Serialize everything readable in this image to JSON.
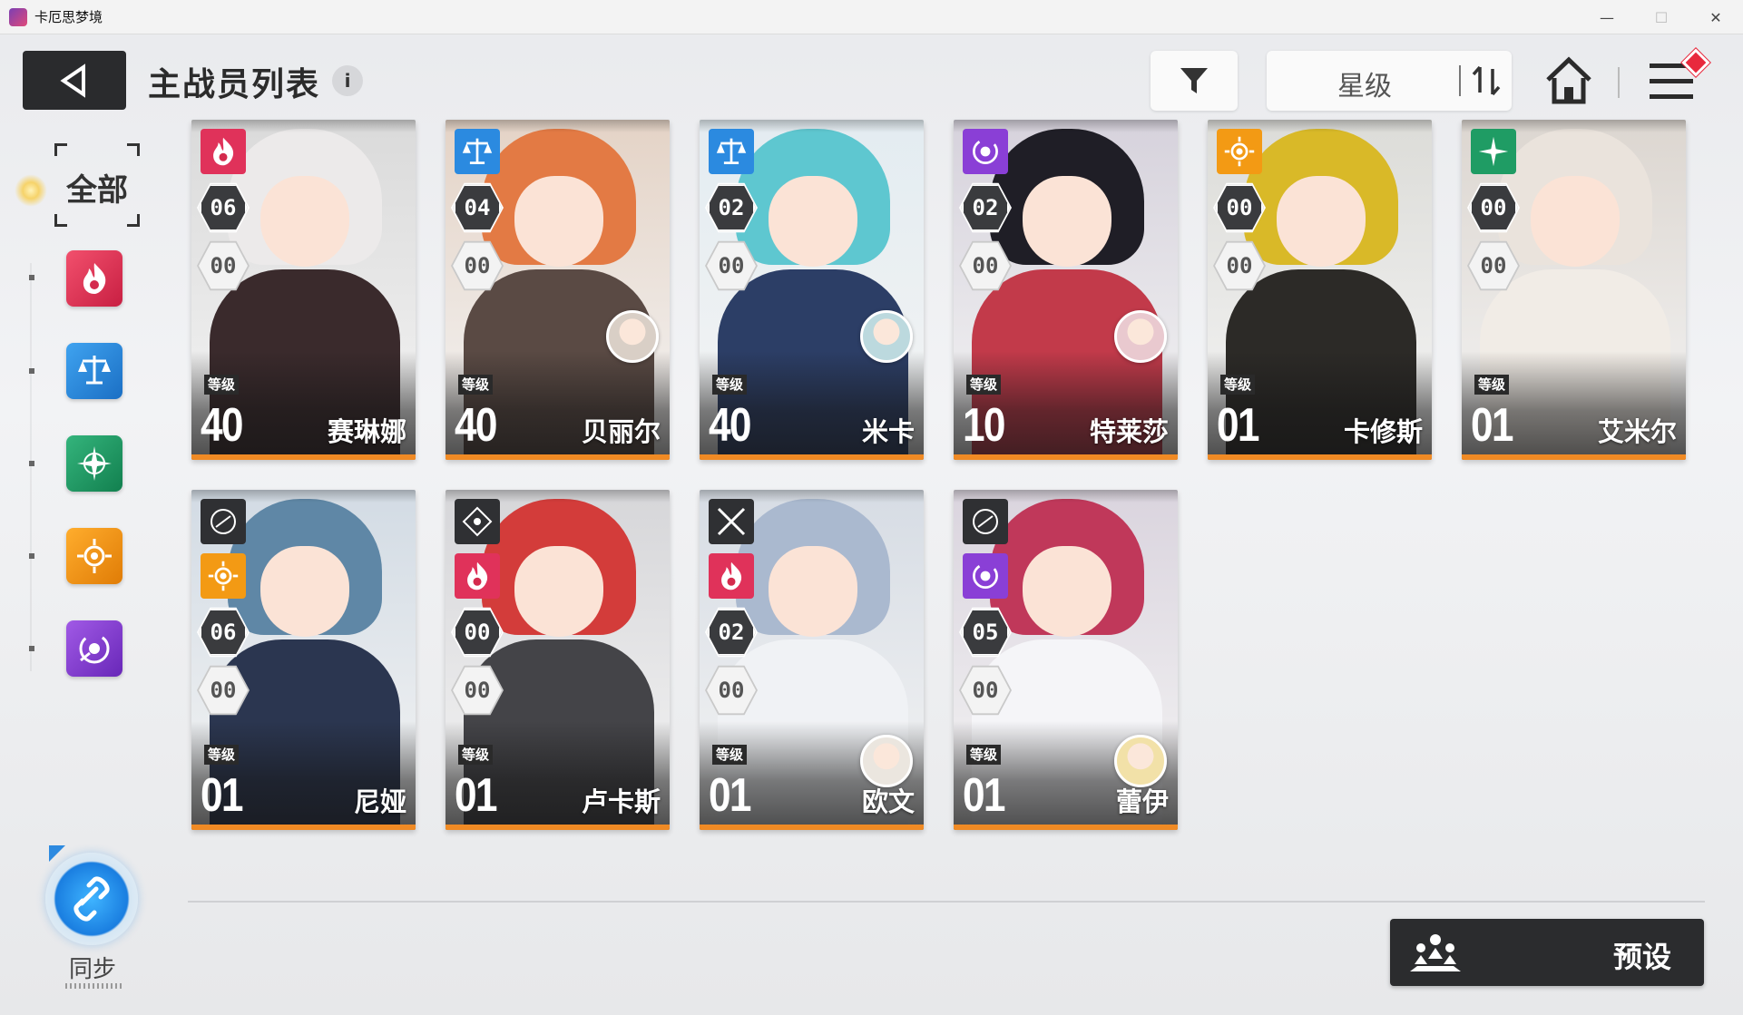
{
  "window": {
    "title": "卡厄思梦境",
    "minimize": "—",
    "maximize": "☐",
    "close": "✕"
  },
  "header": {
    "title": "主战员列表",
    "info": "i",
    "sort_label": "星级"
  },
  "sidebar": {
    "all_label": "全部",
    "elements": [
      "fire",
      "law",
      "wind",
      "sun",
      "void"
    ],
    "sync_label": "同步"
  },
  "cards": [
    {
      "name": "赛琳娜",
      "level_label": "等级",
      "level": "40",
      "stat1": "06",
      "stat2": "00",
      "element": "fire"
    },
    {
      "name": "贝丽尔",
      "level_label": "等级",
      "level": "40",
      "stat1": "04",
      "stat2": "00",
      "element": "law"
    },
    {
      "name": "米卡",
      "level_label": "等级",
      "level": "40",
      "stat1": "02",
      "stat2": "00",
      "element": "law"
    },
    {
      "name": "特莱莎",
      "level_label": "等级",
      "level": "10",
      "stat1": "02",
      "stat2": "00",
      "element": "void"
    },
    {
      "name": "卡修斯",
      "level_label": "等级",
      "level": "01",
      "stat1": "00",
      "stat2": "00",
      "element": "sun"
    },
    {
      "name": "艾米尔",
      "level_label": "等级",
      "level": "01",
      "stat1": "00",
      "stat2": "00",
      "element": "wind"
    },
    {
      "name": "尼娅",
      "level_label": "等级",
      "level": "01",
      "stat1": "06",
      "stat2": "00",
      "element": "sun"
    },
    {
      "name": "卢卡斯",
      "level_label": "等级",
      "level": "01",
      "stat1": "00",
      "stat2": "00",
      "element": "fire"
    },
    {
      "name": "欧文",
      "level_label": "等级",
      "level": "01",
      "stat1": "02",
      "stat2": "00",
      "element": "fire"
    },
    {
      "name": "蕾伊",
      "level_label": "等级",
      "level": "01",
      "stat1": "05",
      "stat2": "00",
      "element": "void"
    }
  ],
  "footer": {
    "preset_label": "预设"
  },
  "colors": {
    "fire": "#e0325a",
    "law": "#2b8ae0",
    "wind": "#1f9c64",
    "sun": "#f39a14",
    "void": "#8a3fd6",
    "accent_orange": "#f08a24"
  }
}
